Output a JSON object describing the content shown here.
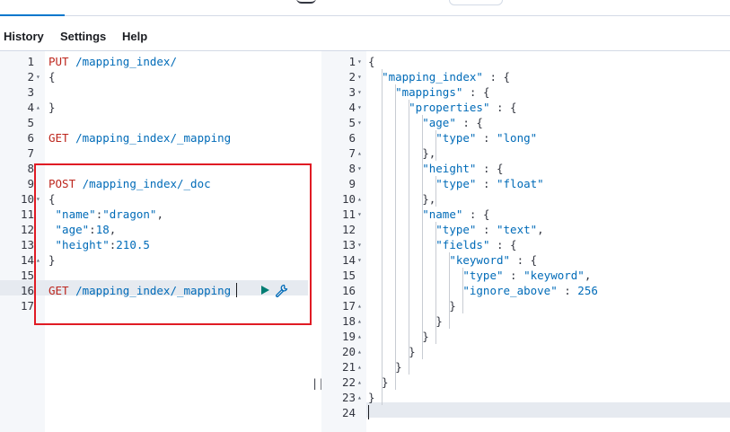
{
  "menubar": {
    "history": "History",
    "settings": "Settings",
    "help": "Help"
  },
  "request_editor": {
    "lines": [
      {
        "n": "1",
        "t": [
          [
            "method",
            "PUT"
          ],
          [
            "url",
            " /mapping_index/"
          ]
        ]
      },
      {
        "n": "2",
        "fold": "▾",
        "t": [
          [
            "punc",
            "{"
          ]
        ]
      },
      {
        "n": "3",
        "t": []
      },
      {
        "n": "4",
        "fold": "▴",
        "t": [
          [
            "punc",
            "}"
          ]
        ]
      },
      {
        "n": "5",
        "t": []
      },
      {
        "n": "6",
        "t": [
          [
            "method",
            "GET"
          ],
          [
            "url",
            " /mapping_index/_mapping"
          ]
        ]
      },
      {
        "n": "7",
        "t": []
      },
      {
        "n": "8",
        "t": []
      },
      {
        "n": "9",
        "t": [
          [
            "method",
            "POST"
          ],
          [
            "url",
            " /mapping_index/_doc"
          ]
        ]
      },
      {
        "n": "10",
        "fold": "▾",
        "t": [
          [
            "punc",
            "{"
          ]
        ]
      },
      {
        "n": "11",
        "t": [
          [
            "punc",
            " "
          ],
          [
            "key",
            "\"name\""
          ],
          [
            "punc",
            ":"
          ],
          [
            "str",
            "\"dragon\""
          ],
          [
            "punc",
            ","
          ]
        ]
      },
      {
        "n": "12",
        "t": [
          [
            "punc",
            " "
          ],
          [
            "key",
            "\"age\""
          ],
          [
            "punc",
            ":"
          ],
          [
            "numv",
            "18"
          ],
          [
            "punc",
            ","
          ]
        ]
      },
      {
        "n": "13",
        "t": [
          [
            "punc",
            " "
          ],
          [
            "key",
            "\"height\""
          ],
          [
            "punc",
            ":"
          ],
          [
            "numv",
            "210.5"
          ]
        ]
      },
      {
        "n": "14",
        "fold": "▴",
        "t": [
          [
            "punc",
            "}"
          ]
        ]
      },
      {
        "n": "15",
        "t": []
      },
      {
        "n": "16",
        "t": [
          [
            "method",
            "GET"
          ],
          [
            "url",
            " /mapping_index/_mapping"
          ]
        ]
      },
      {
        "n": "17",
        "t": []
      }
    ]
  },
  "response_viewer": {
    "lines": [
      {
        "n": "1",
        "fold": "▾",
        "t": [
          [
            "punc",
            "{"
          ]
        ]
      },
      {
        "n": "2",
        "fold": "▾",
        "t": [
          [
            "punc",
            "  "
          ],
          [
            "key",
            "\"mapping_index\""
          ],
          [
            "punc",
            " : {"
          ]
        ]
      },
      {
        "n": "3",
        "fold": "▾",
        "t": [
          [
            "punc",
            "    "
          ],
          [
            "key",
            "\"mappings\""
          ],
          [
            "punc",
            " : {"
          ]
        ]
      },
      {
        "n": "4",
        "fold": "▾",
        "t": [
          [
            "punc",
            "      "
          ],
          [
            "key",
            "\"properties\""
          ],
          [
            "punc",
            " : {"
          ]
        ]
      },
      {
        "n": "5",
        "fold": "▾",
        "t": [
          [
            "punc",
            "        "
          ],
          [
            "key",
            "\"age\""
          ],
          [
            "punc",
            " : {"
          ]
        ]
      },
      {
        "n": "6",
        "t": [
          [
            "punc",
            "          "
          ],
          [
            "key",
            "\"type\""
          ],
          [
            "punc",
            " : "
          ],
          [
            "str",
            "\"long\""
          ]
        ]
      },
      {
        "n": "7",
        "fold": "▴",
        "t": [
          [
            "punc",
            "        },"
          ]
        ]
      },
      {
        "n": "8",
        "fold": "▾",
        "t": [
          [
            "punc",
            "        "
          ],
          [
            "key",
            "\"height\""
          ],
          [
            "punc",
            " : {"
          ]
        ]
      },
      {
        "n": "9",
        "t": [
          [
            "punc",
            "          "
          ],
          [
            "key",
            "\"type\""
          ],
          [
            "punc",
            " : "
          ],
          [
            "str",
            "\"float\""
          ]
        ]
      },
      {
        "n": "10",
        "fold": "▴",
        "t": [
          [
            "punc",
            "        },"
          ]
        ]
      },
      {
        "n": "11",
        "fold": "▾",
        "t": [
          [
            "punc",
            "        "
          ],
          [
            "key",
            "\"name\""
          ],
          [
            "punc",
            " : {"
          ]
        ]
      },
      {
        "n": "12",
        "t": [
          [
            "punc",
            "          "
          ],
          [
            "key",
            "\"type\""
          ],
          [
            "punc",
            " : "
          ],
          [
            "str",
            "\"text\""
          ],
          [
            "punc",
            ","
          ]
        ]
      },
      {
        "n": "13",
        "fold": "▾",
        "t": [
          [
            "punc",
            "          "
          ],
          [
            "key",
            "\"fields\""
          ],
          [
            "punc",
            " : {"
          ]
        ]
      },
      {
        "n": "14",
        "fold": "▾",
        "t": [
          [
            "punc",
            "            "
          ],
          [
            "key",
            "\"keyword\""
          ],
          [
            "punc",
            " : {"
          ]
        ]
      },
      {
        "n": "15",
        "t": [
          [
            "punc",
            "              "
          ],
          [
            "key",
            "\"type\""
          ],
          [
            "punc",
            " : "
          ],
          [
            "str",
            "\"keyword\""
          ],
          [
            "punc",
            ","
          ]
        ]
      },
      {
        "n": "16",
        "t": [
          [
            "punc",
            "              "
          ],
          [
            "key",
            "\"ignore_above\""
          ],
          [
            "punc",
            " : "
          ],
          [
            "numv",
            "256"
          ]
        ]
      },
      {
        "n": "17",
        "fold": "▴",
        "t": [
          [
            "punc",
            "            }"
          ]
        ]
      },
      {
        "n": "18",
        "fold": "▴",
        "t": [
          [
            "punc",
            "          }"
          ]
        ]
      },
      {
        "n": "19",
        "fold": "▴",
        "t": [
          [
            "punc",
            "        }"
          ]
        ]
      },
      {
        "n": "20",
        "fold": "▴",
        "t": [
          [
            "punc",
            "      }"
          ]
        ]
      },
      {
        "n": "21",
        "fold": "▴",
        "t": [
          [
            "punc",
            "    }"
          ]
        ]
      },
      {
        "n": "22",
        "fold": "▴",
        "t": [
          [
            "punc",
            "  }"
          ]
        ]
      },
      {
        "n": "23",
        "fold": "▴",
        "t": [
          [
            "punc",
            "}"
          ]
        ]
      },
      {
        "n": "24",
        "t": []
      }
    ]
  },
  "colors": {
    "method": "#bd271e",
    "token": "#006bb8",
    "highlight": "#e6eaf0",
    "annotation_box": "#e01b24",
    "play": "#017d73"
  },
  "icons": {
    "run": "play-icon",
    "settings": "wrench-icon",
    "resize": "resize-handle-icon"
  }
}
